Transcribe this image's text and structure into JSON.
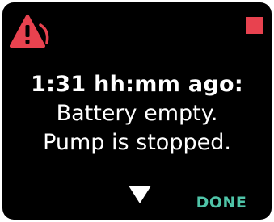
{
  "alert": {
    "icon": "alarm-warning-triangle-icon",
    "accent_color": "#e8424f"
  },
  "status_indicator": {
    "icon": "stop-square-icon",
    "color": "#e8424f"
  },
  "message": {
    "time_line": "1:31 hh:mm ago:",
    "line1": "Battery empty.",
    "line2": "Pump is stopped."
  },
  "controls": {
    "scroll_icon": "down-arrow-icon",
    "done_label": "DONE",
    "done_color": "#4fc4a8"
  }
}
